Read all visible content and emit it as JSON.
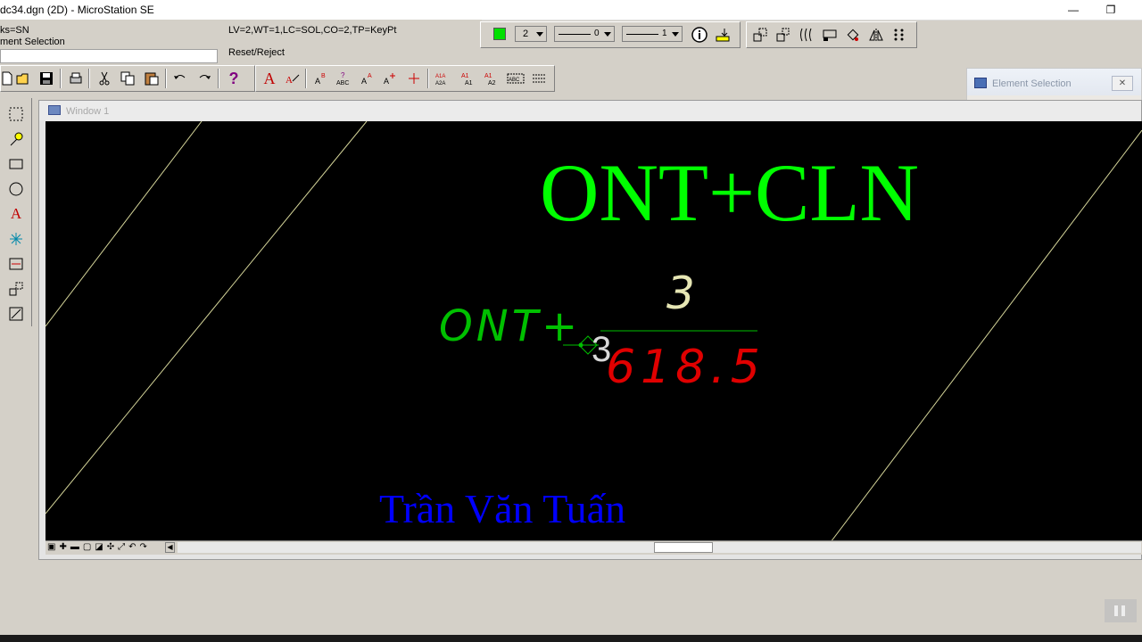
{
  "app": {
    "title": "dc34.dgn (2D) - MicroStation SE",
    "minimize": "—",
    "restore": "❐"
  },
  "status": {
    "locks": "ks=SN",
    "tool": "ment Selection",
    "settings": "LV=2,WT=1,LC=SOL,CO=2,TP=KeyPt",
    "prompt": "Reset/Reject"
  },
  "attributes": {
    "active_color": "#00e000",
    "color_value": "2",
    "linestyle_value": "0",
    "weight_value": "1"
  },
  "element_selection": {
    "title": "Element Selection",
    "close": "✕"
  },
  "window1": {
    "title": "Window 1"
  },
  "drawing": {
    "heading": "ONT+CLN",
    "heading_color": "#00ff00",
    "left_label": "ONT+",
    "left_label_color": "#00c000",
    "numerator": "3",
    "numerator_color": "#e6e6b4",
    "denominator": "618.5",
    "denominator_color": "#e00000",
    "cursor_number": "3",
    "signature": "Trần Văn Tuấn",
    "signature_color": "#0000ff",
    "line_color": "#d6d69a"
  }
}
